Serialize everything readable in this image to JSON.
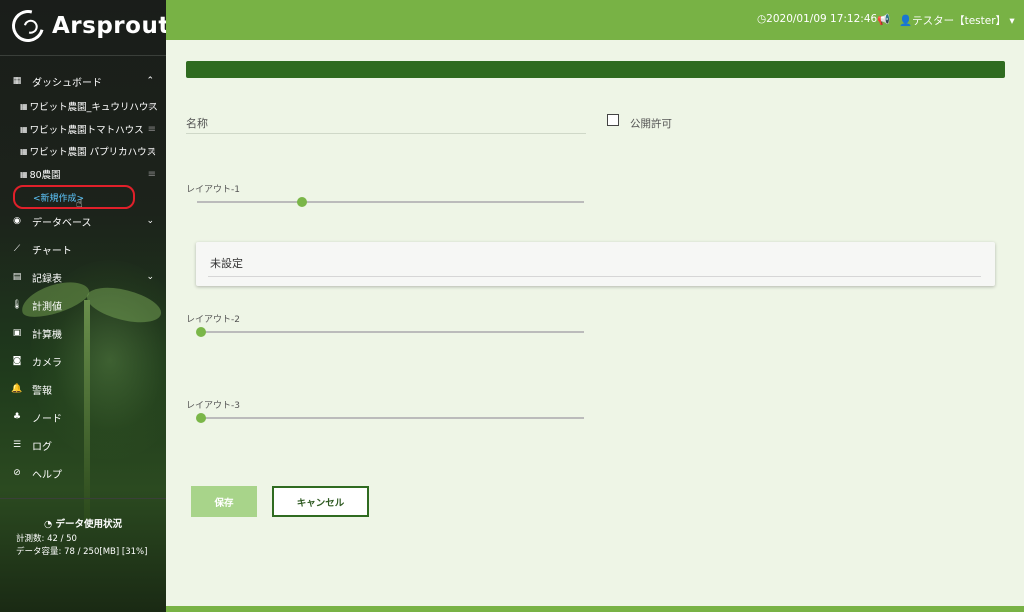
{
  "brand": {
    "name": "Arsprout"
  },
  "topbar": {
    "datetime": "2020/01/09 17:12:46",
    "user": "テスター【tester】"
  },
  "sidebar": {
    "dashboard": "ダッシュボード",
    "dashboards": [
      "ワビット農園_キュウリハウス",
      "ワビット農園トマトハウス",
      "ワビット農園 パプリカハウス",
      "80農園"
    ],
    "new_item": "<新規作成>",
    "items": [
      {
        "label": "データベース",
        "icon": "database-icon"
      },
      {
        "label": "チャート",
        "icon": "line-chart-icon"
      },
      {
        "label": "記録表",
        "icon": "table-icon"
      },
      {
        "label": "計測値",
        "icon": "thermometer-icon"
      },
      {
        "label": "計算機",
        "icon": "calculator-icon"
      },
      {
        "label": "カメラ",
        "icon": "camera-icon"
      },
      {
        "label": "警報",
        "icon": "bell-icon"
      },
      {
        "label": "ノード",
        "icon": "sitemap-icon"
      },
      {
        "label": "ログ",
        "icon": "list-icon"
      },
      {
        "label": "ヘルプ",
        "icon": "help-icon"
      }
    ],
    "usage": {
      "title": "データ使用状況",
      "count": "計測数:  42 / 50",
      "capacity": "データ容量:  78 / 250[MB] [31%]"
    }
  },
  "form": {
    "name_label": "名称",
    "public_label": "公開許可",
    "layout1_label": "レイアウト-1",
    "layout1_value": 0.26,
    "layout2_label": "レイアウト-2",
    "layout2_value": 0,
    "layout3_label": "レイアウト-3",
    "layout3_value": 0,
    "card_title": "未設定",
    "save_label": "保存",
    "cancel_label": "キャンセル"
  },
  "colors": {
    "accent": "#78b245",
    "header_bar": "#2f6b20",
    "highlight": "#e0202a"
  }
}
